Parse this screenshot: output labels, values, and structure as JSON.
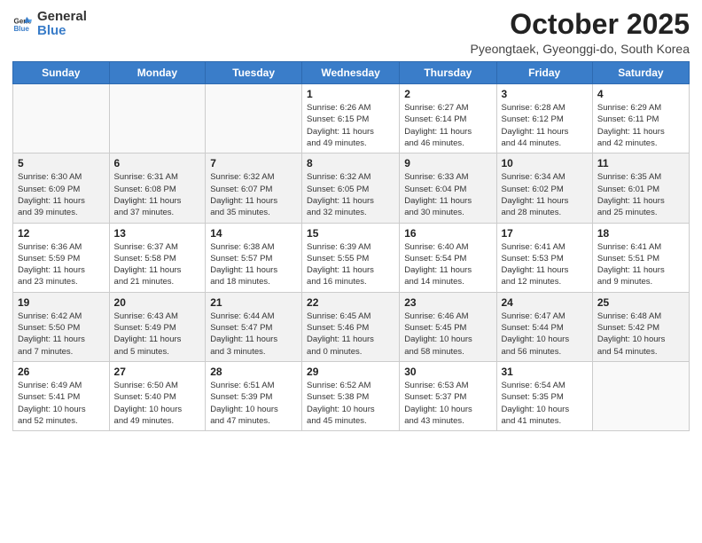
{
  "header": {
    "logo_general": "General",
    "logo_blue": "Blue",
    "month": "October 2025",
    "location": "Pyeongtaek, Gyeonggi-do, South Korea"
  },
  "days_of_week": [
    "Sunday",
    "Monday",
    "Tuesday",
    "Wednesday",
    "Thursday",
    "Friday",
    "Saturday"
  ],
  "weeks": [
    [
      {
        "day": "",
        "info": ""
      },
      {
        "day": "",
        "info": ""
      },
      {
        "day": "",
        "info": ""
      },
      {
        "day": "1",
        "info": "Sunrise: 6:26 AM\nSunset: 6:15 PM\nDaylight: 11 hours\nand 49 minutes."
      },
      {
        "day": "2",
        "info": "Sunrise: 6:27 AM\nSunset: 6:14 PM\nDaylight: 11 hours\nand 46 minutes."
      },
      {
        "day": "3",
        "info": "Sunrise: 6:28 AM\nSunset: 6:12 PM\nDaylight: 11 hours\nand 44 minutes."
      },
      {
        "day": "4",
        "info": "Sunrise: 6:29 AM\nSunset: 6:11 PM\nDaylight: 11 hours\nand 42 minutes."
      }
    ],
    [
      {
        "day": "5",
        "info": "Sunrise: 6:30 AM\nSunset: 6:09 PM\nDaylight: 11 hours\nand 39 minutes."
      },
      {
        "day": "6",
        "info": "Sunrise: 6:31 AM\nSunset: 6:08 PM\nDaylight: 11 hours\nand 37 minutes."
      },
      {
        "day": "7",
        "info": "Sunrise: 6:32 AM\nSunset: 6:07 PM\nDaylight: 11 hours\nand 35 minutes."
      },
      {
        "day": "8",
        "info": "Sunrise: 6:32 AM\nSunset: 6:05 PM\nDaylight: 11 hours\nand 32 minutes."
      },
      {
        "day": "9",
        "info": "Sunrise: 6:33 AM\nSunset: 6:04 PM\nDaylight: 11 hours\nand 30 minutes."
      },
      {
        "day": "10",
        "info": "Sunrise: 6:34 AM\nSunset: 6:02 PM\nDaylight: 11 hours\nand 28 minutes."
      },
      {
        "day": "11",
        "info": "Sunrise: 6:35 AM\nSunset: 6:01 PM\nDaylight: 11 hours\nand 25 minutes."
      }
    ],
    [
      {
        "day": "12",
        "info": "Sunrise: 6:36 AM\nSunset: 5:59 PM\nDaylight: 11 hours\nand 23 minutes."
      },
      {
        "day": "13",
        "info": "Sunrise: 6:37 AM\nSunset: 5:58 PM\nDaylight: 11 hours\nand 21 minutes."
      },
      {
        "day": "14",
        "info": "Sunrise: 6:38 AM\nSunset: 5:57 PM\nDaylight: 11 hours\nand 18 minutes."
      },
      {
        "day": "15",
        "info": "Sunrise: 6:39 AM\nSunset: 5:55 PM\nDaylight: 11 hours\nand 16 minutes."
      },
      {
        "day": "16",
        "info": "Sunrise: 6:40 AM\nSunset: 5:54 PM\nDaylight: 11 hours\nand 14 minutes."
      },
      {
        "day": "17",
        "info": "Sunrise: 6:41 AM\nSunset: 5:53 PM\nDaylight: 11 hours\nand 12 minutes."
      },
      {
        "day": "18",
        "info": "Sunrise: 6:41 AM\nSunset: 5:51 PM\nDaylight: 11 hours\nand 9 minutes."
      }
    ],
    [
      {
        "day": "19",
        "info": "Sunrise: 6:42 AM\nSunset: 5:50 PM\nDaylight: 11 hours\nand 7 minutes."
      },
      {
        "day": "20",
        "info": "Sunrise: 6:43 AM\nSunset: 5:49 PM\nDaylight: 11 hours\nand 5 minutes."
      },
      {
        "day": "21",
        "info": "Sunrise: 6:44 AM\nSunset: 5:47 PM\nDaylight: 11 hours\nand 3 minutes."
      },
      {
        "day": "22",
        "info": "Sunrise: 6:45 AM\nSunset: 5:46 PM\nDaylight: 11 hours\nand 0 minutes."
      },
      {
        "day": "23",
        "info": "Sunrise: 6:46 AM\nSunset: 5:45 PM\nDaylight: 10 hours\nand 58 minutes."
      },
      {
        "day": "24",
        "info": "Sunrise: 6:47 AM\nSunset: 5:44 PM\nDaylight: 10 hours\nand 56 minutes."
      },
      {
        "day": "25",
        "info": "Sunrise: 6:48 AM\nSunset: 5:42 PM\nDaylight: 10 hours\nand 54 minutes."
      }
    ],
    [
      {
        "day": "26",
        "info": "Sunrise: 6:49 AM\nSunset: 5:41 PM\nDaylight: 10 hours\nand 52 minutes."
      },
      {
        "day": "27",
        "info": "Sunrise: 6:50 AM\nSunset: 5:40 PM\nDaylight: 10 hours\nand 49 minutes."
      },
      {
        "day": "28",
        "info": "Sunrise: 6:51 AM\nSunset: 5:39 PM\nDaylight: 10 hours\nand 47 minutes."
      },
      {
        "day": "29",
        "info": "Sunrise: 6:52 AM\nSunset: 5:38 PM\nDaylight: 10 hours\nand 45 minutes."
      },
      {
        "day": "30",
        "info": "Sunrise: 6:53 AM\nSunset: 5:37 PM\nDaylight: 10 hours\nand 43 minutes."
      },
      {
        "day": "31",
        "info": "Sunrise: 6:54 AM\nSunset: 5:35 PM\nDaylight: 10 hours\nand 41 minutes."
      },
      {
        "day": "",
        "info": ""
      }
    ]
  ]
}
